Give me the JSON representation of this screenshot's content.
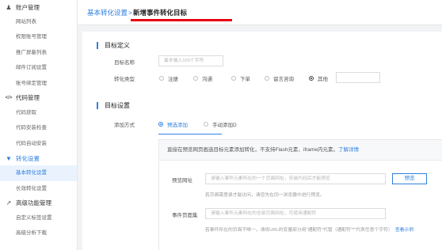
{
  "sidebar": {
    "groups": [
      {
        "icon": "person-icon",
        "glyph": "👤",
        "label": "账户管理",
        "items": [
          "网站列表",
          "权限账号管理",
          "推广屏蔽列表",
          "邮件订阅设置",
          "账号绑定管理"
        ]
      },
      {
        "icon": "code-icon",
        "glyph": "</>",
        "label": "代码管理",
        "items": [
          "代码获取",
          "代码安装检查",
          "代码自动安装"
        ]
      },
      {
        "icon": "funnel-icon",
        "glyph": "▼",
        "label": "转化设置",
        "items": [
          "基本转化设置",
          "长效转化设置"
        ]
      },
      {
        "icon": "chart-icon",
        "glyph": "↗",
        "label": "高级功能管理",
        "items": [
          "自定义标签设置",
          "高级分析下载"
        ]
      }
    ],
    "active_item": "基本转化设置"
  },
  "breadcrumb": {
    "parent": "基本转化设置",
    "separator": ">",
    "current": "新增事件转化目标"
  },
  "goal_def": {
    "title": "目标定义",
    "name_label": "目标名称",
    "name_placeholder": "最多输入100个字符",
    "type_label": "转化类型",
    "types": [
      "注册",
      "沟通",
      "下单",
      "留言咨询",
      "其他"
    ],
    "selected_type": "其他"
  },
  "goal_set": {
    "title": "目标设置",
    "method_label": "添加方式",
    "methods": [
      "预选添加",
      "手动添加D"
    ],
    "selected_method": "预选添加",
    "hint_text": "直接在预览网页画选目标元素添加转化，不支持Flash元素、iframe内元素。",
    "hint_link": "了解详情",
    "preview_label": "预览网址",
    "preview_placeholder": "请输入事件元素所在的一个页面网址，安装代码后才能预览",
    "preview_button": "预览",
    "preview_note": "若页面需登录才能访问，请您先在同一浏览器中进行预览。",
    "event_label": "事件页面集",
    "event_placeholder": "请输入事件元素所在的全部页面网址，可使用通配符",
    "event_note": "若事件所在的页面不唯一，请将URL的变量部分用\"通配符\"代替（通配符\"*\"代表任意个字符）",
    "event_link": "查看示例"
  }
}
